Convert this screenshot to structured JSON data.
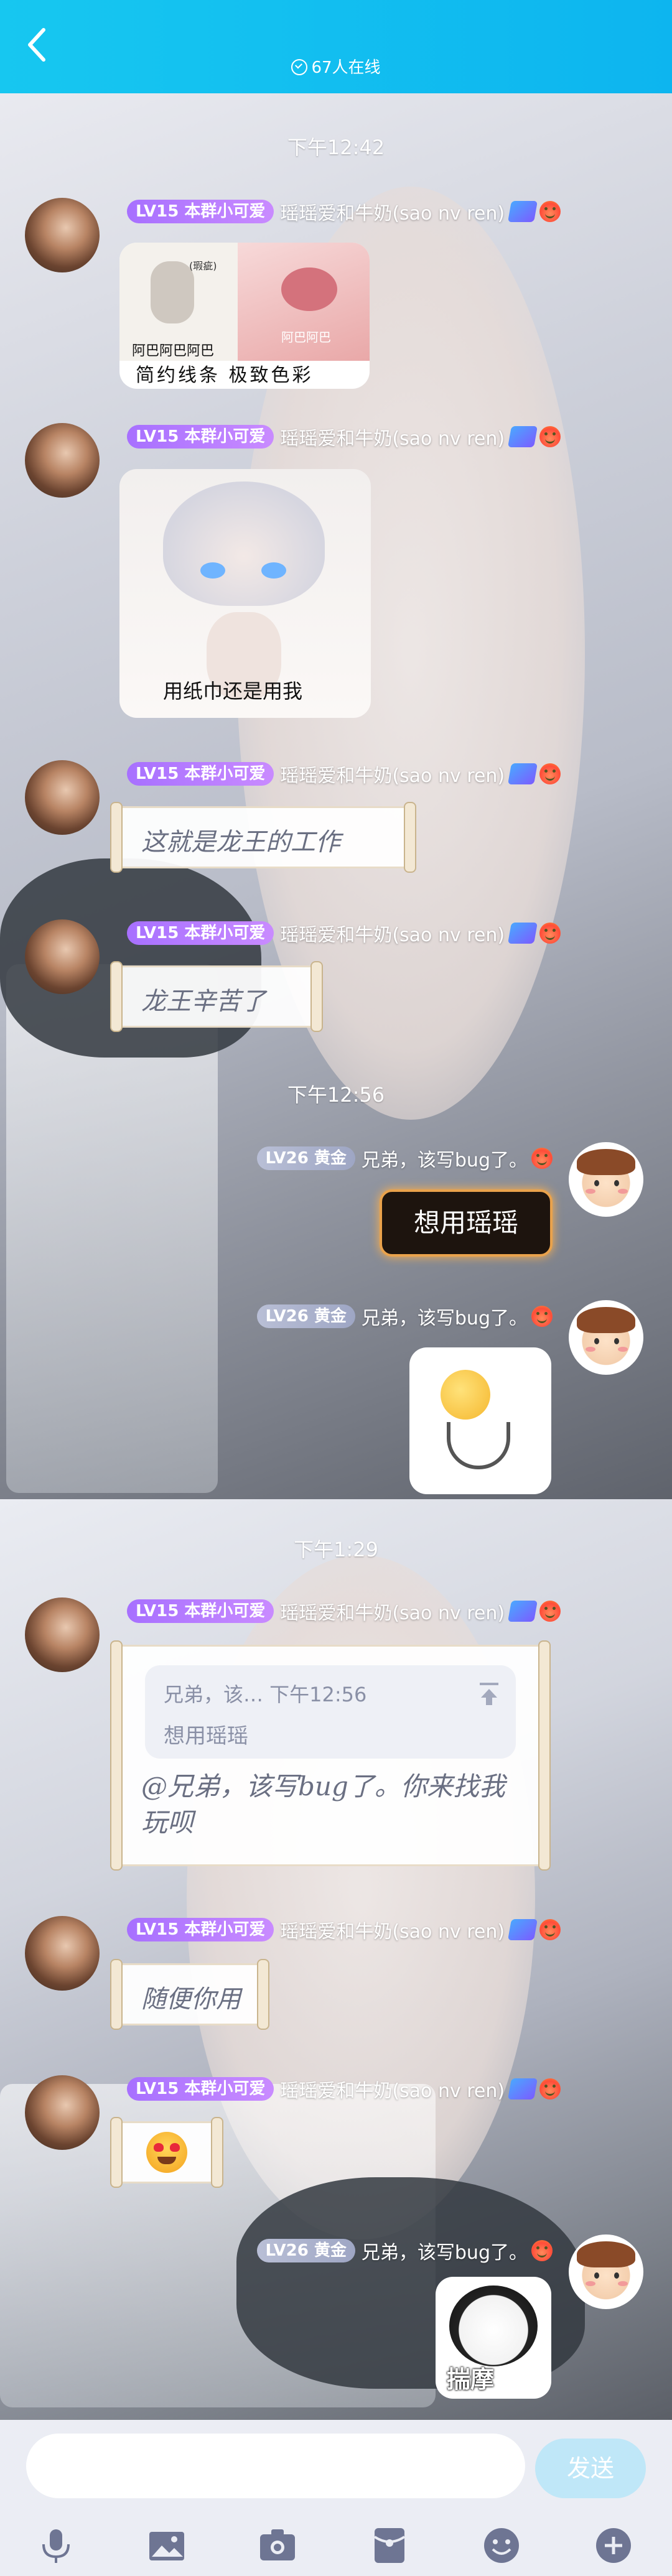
{
  "header": {
    "online": "67人在线"
  },
  "times": {
    "t1": "下午12:42",
    "t2": "下午12:56",
    "t3": "下午1:29"
  },
  "member_badge": "LV15 本群小可爱",
  "member_nick": "瑶瑶爱和牛奶(sao nv ren)",
  "friend_badge": "LV26 黄金",
  "friend_nick": "兄弟，该写bug了。",
  "messages": {
    "m1": {
      "left_label": "(瑕疵)",
      "left_cap": "阿巴阿巴阿巴",
      "right_cap": "阿巴阿巴",
      "caption": "简约线条 极致色彩"
    },
    "m2": {
      "caption": "用纸巾还是用我"
    },
    "m3": {
      "text": "这就是龙王的工作"
    },
    "m4": {
      "text": "龙王辛苦了"
    },
    "m5": {
      "text": "想用瑶瑶"
    },
    "m7": {
      "quote_head": "兄弟，该…  下午12:56",
      "quote_body": "想用瑶瑶",
      "text": "@兄弟，该写bug了。你来找我玩呗"
    },
    "m8": {
      "text": "随便你用"
    },
    "m10": {
      "caption": "揣摩"
    }
  },
  "input": {
    "placeholder": "",
    "send": "发送"
  },
  "toolbar": [
    "mic-icon",
    "image-icon",
    "camera-icon",
    "redpacket-icon",
    "emoji-icon",
    "plus-icon"
  ]
}
